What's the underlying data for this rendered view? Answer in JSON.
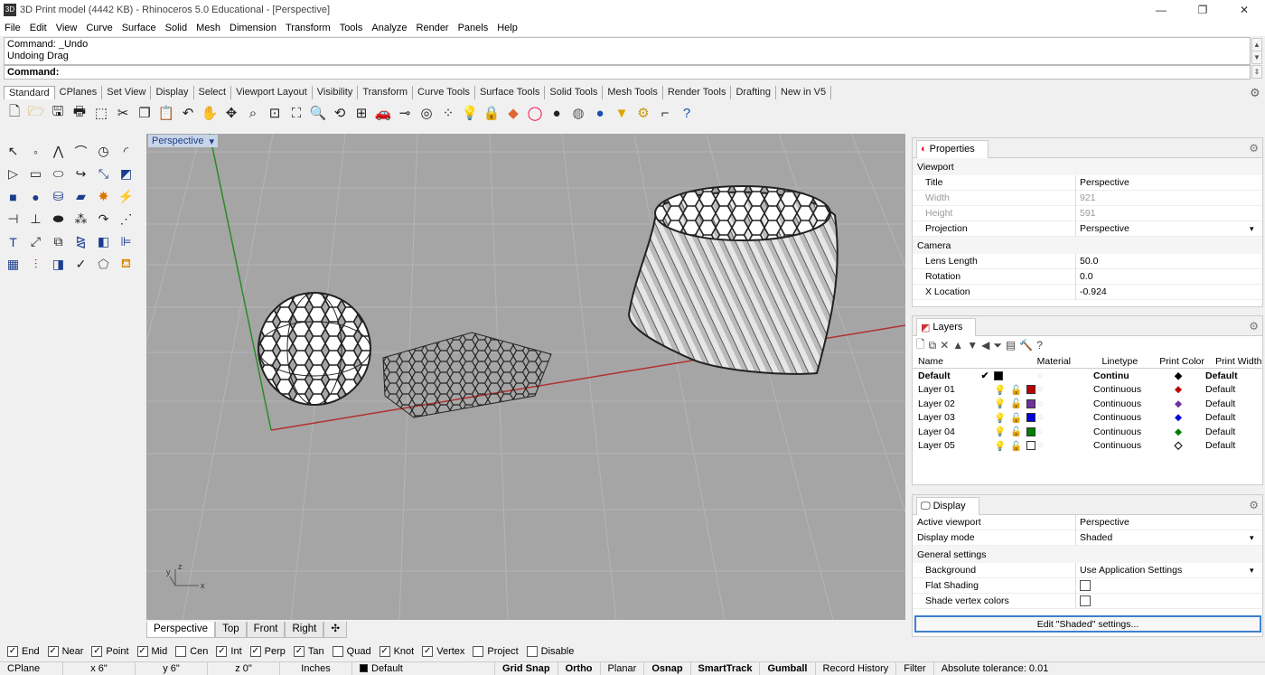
{
  "window": {
    "title": "3D Print model (4442 KB) - Rhinoceros 5.0 Educational - [Perspective]"
  },
  "menu": [
    "File",
    "Edit",
    "View",
    "Curve",
    "Surface",
    "Solid",
    "Mesh",
    "Dimension",
    "Transform",
    "Tools",
    "Analyze",
    "Render",
    "Panels",
    "Help"
  ],
  "command": {
    "history": [
      "Command: _Undo",
      "Undoing Drag"
    ],
    "prompt": "Command:"
  },
  "toolbar_tabs": [
    "Standard",
    "CPlanes",
    "Set View",
    "Display",
    "Select",
    "Viewport Layout",
    "Visibility",
    "Transform",
    "Curve Tools",
    "Surface Tools",
    "Solid Tools",
    "Mesh Tools",
    "Render Tools",
    "Drafting",
    "New in V5"
  ],
  "viewport": {
    "label": "Perspective",
    "tabs": [
      "Perspective",
      "Top",
      "Front",
      "Right"
    ],
    "axes": {
      "x": "x",
      "y": "y",
      "z": "z"
    }
  },
  "properties": {
    "tab": "Properties",
    "sections": [
      {
        "name": "Viewport",
        "rows": [
          {
            "k": "Title",
            "v": "Perspective"
          },
          {
            "k": "Width",
            "v": "921"
          },
          {
            "k": "Height",
            "v": "591"
          },
          {
            "k": "Projection",
            "v": "Perspective"
          }
        ]
      },
      {
        "name": "Camera",
        "rows": [
          {
            "k": "Lens Length",
            "v": "50.0"
          },
          {
            "k": "Rotation",
            "v": "0.0"
          },
          {
            "k": "X Location",
            "v": "-0.924"
          }
        ]
      }
    ]
  },
  "layers": {
    "tab": "Layers",
    "headers": [
      "Name",
      "Material",
      "Linetype",
      "Print Color",
      "Print Width"
    ],
    "rows": [
      {
        "name": "Default",
        "linetype": "Continu",
        "width": "Default",
        "color": "#000000",
        "current": "✔",
        "bold": true
      },
      {
        "name": "Layer 01",
        "linetype": "Continuous",
        "width": "Default",
        "color": "#c00000",
        "current": ""
      },
      {
        "name": "Layer 02",
        "linetype": "Continuous",
        "width": "Default",
        "color": "#7030a0",
        "current": ""
      },
      {
        "name": "Layer 03",
        "linetype": "Continuous",
        "width": "Default",
        "color": "#0000e0",
        "current": ""
      },
      {
        "name": "Layer 04",
        "linetype": "Continuous",
        "width": "Default",
        "color": "#008000",
        "current": ""
      },
      {
        "name": "Layer 05",
        "linetype": "Continuous",
        "width": "Default",
        "color": "#ffffff",
        "current": ""
      }
    ]
  },
  "display": {
    "tab": "Display",
    "rows": [
      {
        "k": "Active viewport",
        "v": "Perspective"
      },
      {
        "k": "Display mode",
        "v": "Shaded"
      }
    ],
    "section": "General settings",
    "settings": [
      {
        "k": "Background",
        "v": "Use Application Settings"
      },
      {
        "k": "Flat Shading",
        "v": ""
      },
      {
        "k": "Shade vertex colors",
        "v": ""
      }
    ],
    "button": "Edit \"Shaded\" settings..."
  },
  "osnap": [
    {
      "label": "End",
      "checked": true
    },
    {
      "label": "Near",
      "checked": true
    },
    {
      "label": "Point",
      "checked": true
    },
    {
      "label": "Mid",
      "checked": true
    },
    {
      "label": "Cen",
      "checked": false
    },
    {
      "label": "Int",
      "checked": true
    },
    {
      "label": "Perp",
      "checked": true
    },
    {
      "label": "Tan",
      "checked": true
    },
    {
      "label": "Quad",
      "checked": false
    },
    {
      "label": "Knot",
      "checked": true
    },
    {
      "label": "Vertex",
      "checked": true
    },
    {
      "label": "Project",
      "checked": false
    },
    {
      "label": "Disable",
      "checked": false
    }
  ],
  "status": {
    "cplane": "CPlane",
    "x": "x 6\"",
    "y": "y 6\"",
    "z": "z 0\"",
    "units": "Inches",
    "layer": "Default",
    "toggles": [
      "Grid Snap",
      "Ortho",
      "Planar",
      "Osnap",
      "SmartTrack",
      "Gumball",
      "Record History",
      "Filter"
    ],
    "tolerance": "Absolute tolerance: 0.01"
  }
}
